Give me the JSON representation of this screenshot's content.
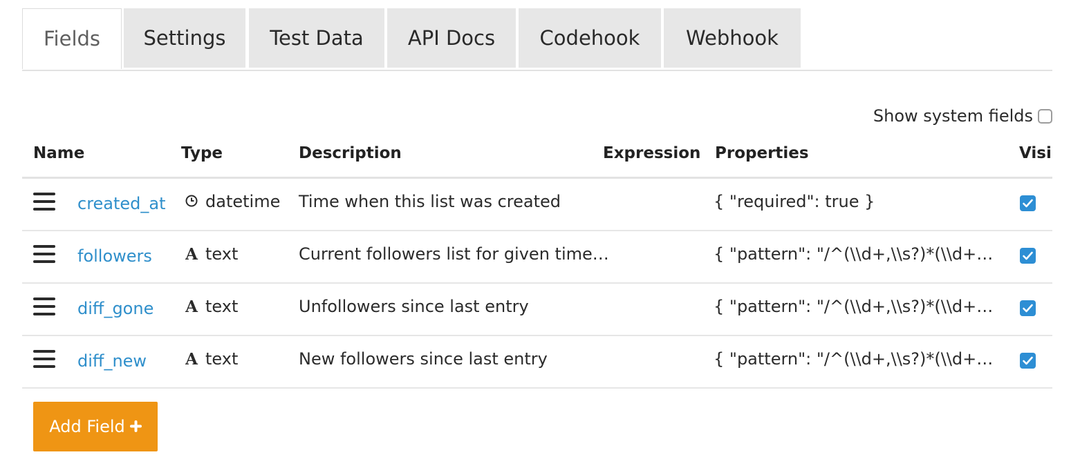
{
  "tabs": [
    {
      "label": "Fields",
      "active": true
    },
    {
      "label": "Settings"
    },
    {
      "label": "Test Data"
    },
    {
      "label": "API Docs"
    },
    {
      "label": "Codehook"
    },
    {
      "label": "Webhook"
    }
  ],
  "system_fields_toggle": {
    "label": "Show system fields",
    "checked": false
  },
  "table": {
    "columns": [
      "Name",
      "Type",
      "Description",
      "Expression",
      "Properties",
      "Visil"
    ],
    "rows": [
      {
        "name": "created_at",
        "type": "datetime",
        "type_icon": "clock-icon",
        "description": "Time when this list was created",
        "expression": "",
        "properties": "{ \"required\": true }",
        "visible": true
      },
      {
        "name": "followers",
        "type": "text",
        "type_icon": "text-type-icon",
        "description": "Current followers list for given time…",
        "expression": "",
        "properties": "{ \"pattern\": \"/^(\\\\d+,\\\\s?)*(\\\\d+)$/\", …",
        "visible": true
      },
      {
        "name": "diff_gone",
        "type": "text",
        "type_icon": "text-type-icon",
        "description": "Unfollowers since last entry",
        "expression": "",
        "properties": "{ \"pattern\": \"/^(\\\\d+,\\\\s?)*(\\\\d+)$/\" }",
        "visible": true
      },
      {
        "name": "diff_new",
        "type": "text",
        "type_icon": "text-type-icon",
        "description": "New followers since last entry",
        "expression": "",
        "properties": "{ \"pattern\": \"/^(\\\\d+,\\\\s?)*(\\\\d+)$/\" }",
        "visible": true
      }
    ]
  },
  "add_field_button": {
    "label": "Add Field",
    "icon": "plus-icon"
  },
  "colors": {
    "link": "#2f8fcb",
    "button": "#ef9514",
    "checkbox": "#2d8ed4",
    "tab_inactive": "#e7e7e7"
  }
}
